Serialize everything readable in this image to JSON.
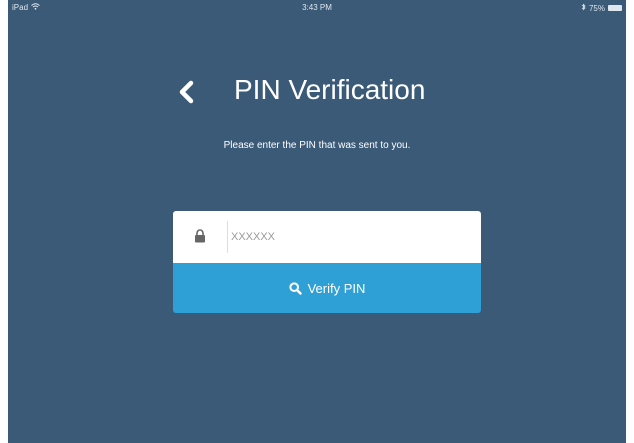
{
  "status_bar": {
    "device": "iPad",
    "wifi_icon": "wifi-icon",
    "time": "3:43 PM",
    "bluetooth_icon": "bluetooth-icon",
    "battery": "75%"
  },
  "header": {
    "back_icon": "chevron-left-icon",
    "title": "PIN Verification"
  },
  "subtitle": "Please enter the PIN that was sent to you.",
  "pin_field": {
    "icon": "lock-icon",
    "placeholder": "XXXXXX",
    "value": ""
  },
  "verify_button": {
    "icon": "search-icon",
    "label": "Verify PIN"
  },
  "colors": {
    "background": "#3a5a78",
    "button": "#2fa0d6",
    "text": "#ffffff"
  }
}
